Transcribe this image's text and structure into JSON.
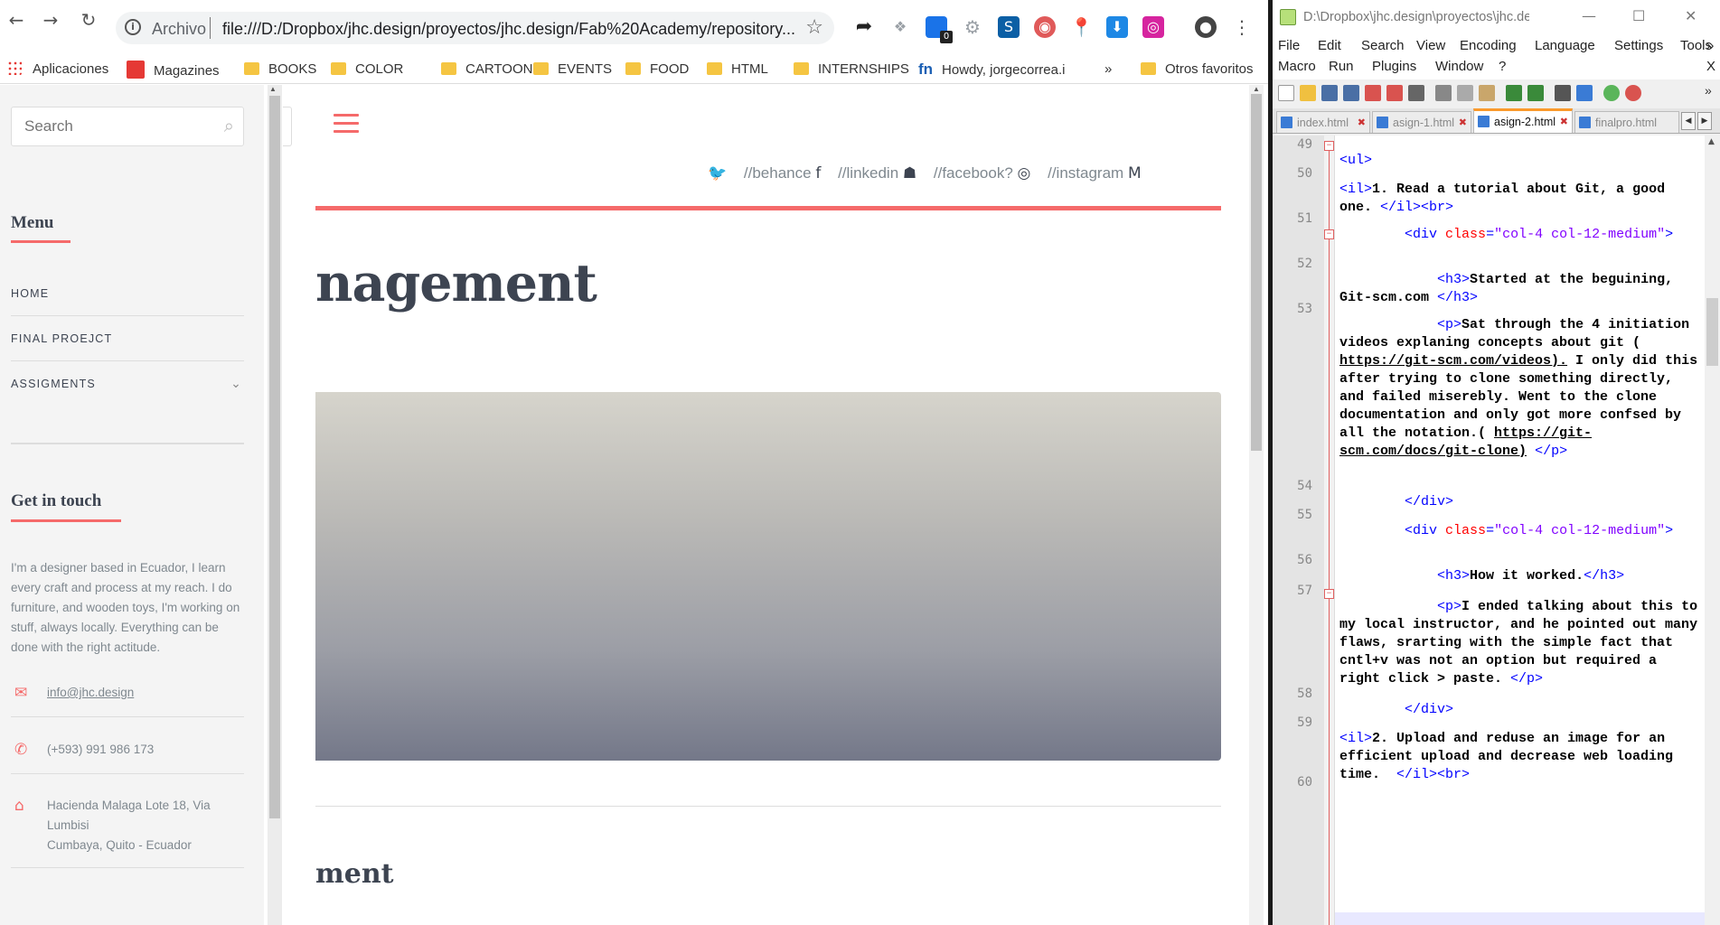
{
  "browser": {
    "back": "←",
    "forward": "→",
    "reload": "↻",
    "info": "i",
    "scheme": "Archivo",
    "url": "file:///D:/Dropbox/jhc.design/proyectos/jhc.design/Fab%20Academy/repository...",
    "star": "☆",
    "bookmarks": [
      {
        "label": "Aplicaciones",
        "icon": "apps-grid-icon"
      },
      {
        "label": "Magazines",
        "icon": "flipboard-icon"
      },
      {
        "label": "BOOKS",
        "icon": "folder-icon"
      },
      {
        "label": "COLOR",
        "icon": "folder-icon"
      },
      {
        "label": "CARTOONS",
        "icon": "folder-icon"
      },
      {
        "label": "EVENTS",
        "icon": "folder-icon"
      },
      {
        "label": "FOOD",
        "icon": "folder-icon"
      },
      {
        "label": "HTML",
        "icon": "folder-icon"
      },
      {
        "label": "INTERNSHIPS",
        "icon": "folder-icon"
      },
      {
        "label": "Howdy, jorgecorrea.i",
        "icon": "fn-icon"
      }
    ],
    "more_bookmarks": "»",
    "other_bookmarks": "Otros favoritos",
    "extension_badge": "0",
    "menu": "⋮"
  },
  "site": {
    "search_placeholder": "Search",
    "menu_heading": "Menu",
    "nav": [
      {
        "label": "HOME"
      },
      {
        "label": "FINAL PROEJCT"
      },
      {
        "label": "ASSIGMENTS"
      }
    ],
    "touch_heading": "Get in touch",
    "about": "I'm a designer based in Ecuador, I learn every craft and process at my reach. I do furniture, and wooden toys, I'm working on stuff, always locally. Everything can be done with the right actitude.",
    "email": "info@jhc.design",
    "phone": "(+593) 991 986 173",
    "address_line1": "Hacienda Malaga Lote 18, Via Lumbisi",
    "address_line2": "Cumbaya, Quito - Ecuador",
    "social": {
      "behance": "//behance",
      "linkedin": "//linkedin",
      "facebook": "//facebook?",
      "instagram": "//instagram"
    },
    "title": "nagement",
    "subtitle": "ment"
  },
  "npp": {
    "title": "D:\\Dropbox\\jhc.design\\proyectos\\jhc.desi...",
    "minimize": "—",
    "maximize": "☐",
    "close": "✕",
    "menu_row1": [
      "File",
      "Edit",
      "Search",
      "View",
      "Encoding",
      "Language",
      "Settings",
      "Tools"
    ],
    "menu_row2": [
      "Macro",
      "Run",
      "Plugins",
      "Window",
      "?"
    ],
    "menu_close": "X",
    "menu_more": "»",
    "tabs": [
      {
        "label": "index.html",
        "active": false
      },
      {
        "label": "asign-1.html",
        "active": false
      },
      {
        "label": "asign-2.html",
        "active": true
      },
      {
        "label": "finalpro.html",
        "active": false
      }
    ],
    "lines": [
      {
        "num": "49",
        "html": "<span class='tag'>&lt;ul&gt;</span>"
      },
      {
        "num": "50",
        "html": "<span class='tag'>&lt;il&gt;</span>1. Read a tutorial about Git, a good one. <span class='tag'>&lt;/il&gt;&lt;br&gt;</span>"
      },
      {
        "num": "51",
        "html": "        <span class='tag'>&lt;div</span> <span class='attr'>class</span><span class='tag'>=</span><span class='val'>\"col-4 col-12-medium\"</span><span class='tag'>&gt;</span>"
      },
      {
        "num": "52",
        "html": "            <span class='tag'>&lt;h3&gt;</span>Started at the beguining, Git-scm.com <span class='tag'>&lt;/h3&gt;</span>"
      },
      {
        "num": "53",
        "html": "            <span class='tag'>&lt;p&gt;</span>Sat through the 4 initiation videos explaning concepts about git ( <span class='ul'>https://git-scm.com/videos).</span> I only did this after trying to clone something directly, and failed miserebly. Went to the clone documentation and only got more confsed by all the notation.( <span class='ul'>https://git-scm.com/docs/git-clone)</span> <span class='tag'>&lt;/p&gt;</span>"
      },
      {
        "num": "54",
        "html": "        <span class='tag'>&lt;/div&gt;</span>"
      },
      {
        "num": "55",
        "html": "        <span class='tag'>&lt;div</span> <span class='attr'>class</span><span class='tag'>=</span><span class='val'>\"col-4 col-12-medium\"</span><span class='tag'>&gt;</span>"
      },
      {
        "num": "56",
        "html": "            <span class='tag'>&lt;h3&gt;</span>How it worked.<span class='tag'>&lt;/h3&gt;</span>"
      },
      {
        "num": "57",
        "html": "            <span class='tag'>&lt;p&gt;</span>I ended talking about this to my local instructor, and he pointed out many flaws, srarting with the simple fact that cntl+v was not an option but required a right click &gt; paste. <span class='tag'>&lt;/p&gt;</span>"
      },
      {
        "num": "58",
        "html": "        <span class='tag'>&lt;/div&gt;</span>"
      },
      {
        "num": "59",
        "html": "<span class='tag'>&lt;il&gt;</span>2. Upload and reduse an image for an efficient upload and decrease web loading time.  <span class='tag'>&lt;/il&gt;&lt;br&gt;</span>"
      },
      {
        "num": "60",
        "html": ""
      }
    ]
  },
  "colors": {
    "accent": "#f56a6a",
    "heading": "#3d4451",
    "tag": "#0000ff",
    "attr": "#ff0000",
    "attr_value": "#8000ff",
    "active_tab": "#fa9a2c"
  }
}
